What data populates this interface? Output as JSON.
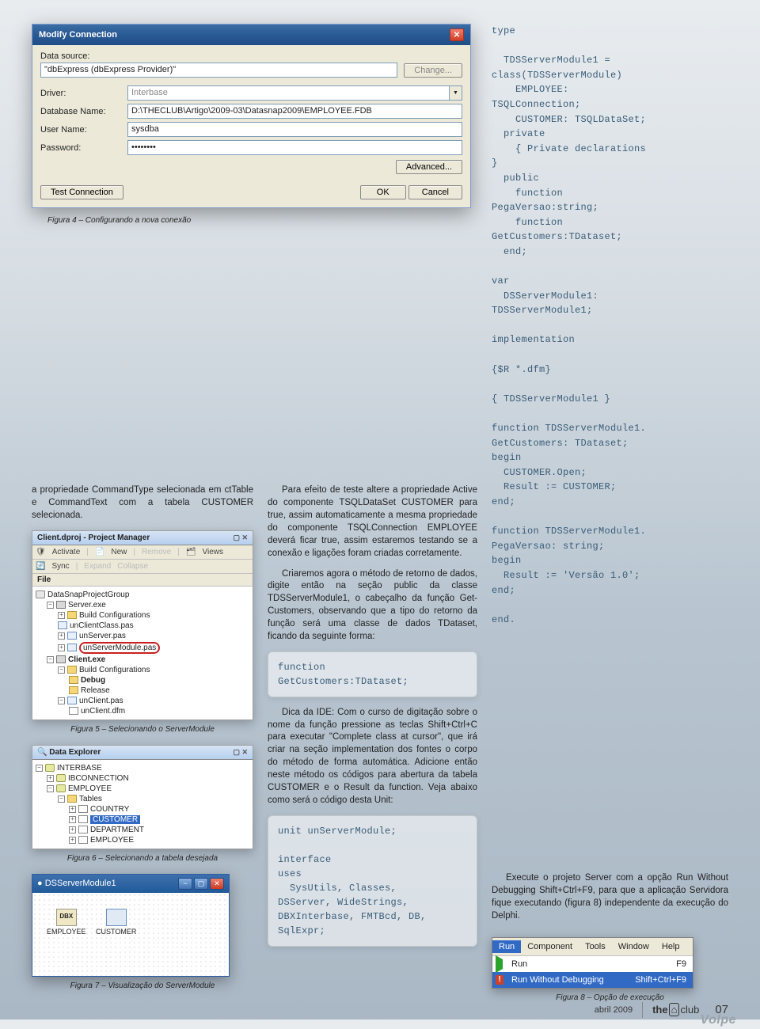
{
  "dialog": {
    "title": "Modify Connection",
    "data_source_label": "Data source:",
    "data_source_value": "\"dbExpress (dbExpress Provider)\"",
    "change": "Change...",
    "driver_label": "Driver:",
    "driver_value": "Interbase",
    "dbname_label": "Database Name:",
    "dbname_value": "D:\\THECLUB\\Artigo\\2009-03\\Datasnap2009\\EMPLOYEE.FDB",
    "user_label": "User Name:",
    "user_value": "sysdba",
    "pass_label": "Password:",
    "pass_value": "••••••••",
    "advanced": "Advanced...",
    "test": "Test Connection",
    "ok": "OK",
    "cancel": "Cancel"
  },
  "captions": {
    "fig4": "Figura 4 – Configurando a nova conexão",
    "fig5": "Figura 5 – Selecionando o ServerModule",
    "fig6": "Figura 6 – Selecionando a tabela desejada",
    "fig7": "Figura 7 – Visualização do ServerModule",
    "fig8": "Figura 8 – Opção de execução"
  },
  "para": {
    "p1": "a propriedade CommandType selecionada em ctTable e CommandText com a tabela CUSTOMER selecionada.",
    "p2": "Para efeito de teste altere a propriedade Active do componente TSQLDataSet CUSTOMER para true, assim automaticamente a mesma propriedade do componente TSQLConnection EMPLOYEE deverá ficar true, assim estaremos testando se a conexão e ligações foram criadas corretamente.",
    "p3": "Criaremos agora o método de retorno de dados, digite então na seção public da classe TDSServerModule1, o cabeçalho da função Get-Customers, observando que a tipo do retorno da função será uma classe de dados TDataset, ficando da seguinte forma:",
    "p4": "Dica da IDE: Com o curso de digitação sobre o nome da função pressione as teclas Shift+Ctrl+C para executar \"Complete class at cursor\", que irá criar na seção implementation dos fontes o corpo do método de forma automática. Adicione então neste método os códigos para abertura da tabela CUSTOMER e o Result da function. Veja abaixo como será o código desta Unit:",
    "p5": "Execute o projeto Server com a opção Run Without Debugging Shift+Ctrl+F9, para que a aplicação Servidora fique executando (figura 8) independente da execução do Delphi."
  },
  "snippets": {
    "func": "function\nGetCustomers:TDataset;",
    "unit": "unit unServerModule;\n\ninterface\nuses\n  SysUtils, Classes,\nDSServer, WideStrings,\nDBXInterbase, FMTBcd, DB,\nSqlExpr;",
    "class": "type\n\n  TDSServerModule1 =\nclass(TDSServerModule)\n    EMPLOYEE:\nTSQLConnection;\n    CUSTOMER: TSQLDataSet;\n  private\n    { Private declarations\n}\n  public\n    function\nPegaVersao:string;\n    function\nGetCustomers:TDataset;\n  end;\n\nvar\n  DSServerModule1:\nTDSServerModule1;\n\nimplementation\n\n{$R *.dfm}\n\n{ TDSServerModule1 }\n\nfunction TDSServerModule1.\nGetCustomers: TDataset;\nbegin\n  CUSTOMER.Open;\n  Result := CUSTOMER;\nend;\n\nfunction TDSServerModule1.\nPegaVersao: string;\nbegin\n  Result := 'Versão 1.0';\nend;\n\nend."
  },
  "pm": {
    "title": "Client.dproj - Project Manager",
    "activate": "Activate",
    "new": "New",
    "remove": "Remove",
    "views": "Views",
    "sync": "Sync",
    "expand": "Expand",
    "collapse": "Collapse",
    "file_hdr": "File",
    "items": {
      "root": "DataSnapProjectGroup",
      "server": "Server.exe",
      "build": "Build Configurations",
      "unclient": "unClientClass.pas",
      "unserverp": "unServer.pas",
      "unservermod": "unServerModule.pas",
      "client": "Client.exe",
      "debug": "Debug",
      "release": "Release",
      "clientpas": "unClient.pas",
      "clientdfm": "unClient.dfm"
    }
  },
  "de": {
    "title": "Data Explorer",
    "interbase": "INTERBASE",
    "ibconn": "IBCONNECTION",
    "employee": "EMPLOYEE",
    "tables": "Tables",
    "t1": "COUNTRY",
    "t2": "CUSTOMER",
    "t3": "DEPARTMENT",
    "t4": "EMPLOYEE"
  },
  "ss": {
    "title": "DSServerModule1",
    "emp": "EMPLOYEE",
    "cust": "CUSTOMER"
  },
  "menu": {
    "run_tab": "Run",
    "component": "Component",
    "tools": "Tools",
    "window": "Window",
    "help": "Help",
    "run": "Run",
    "run_sc": "F9",
    "rwd": "Run Without Debugging",
    "rwd_sc": "Shift+Ctrl+F9"
  },
  "footer": {
    "month": "abril 2009",
    "brand_pre": "the",
    "brand_suf": "club",
    "page": "07",
    "watermark": "Volpe"
  }
}
